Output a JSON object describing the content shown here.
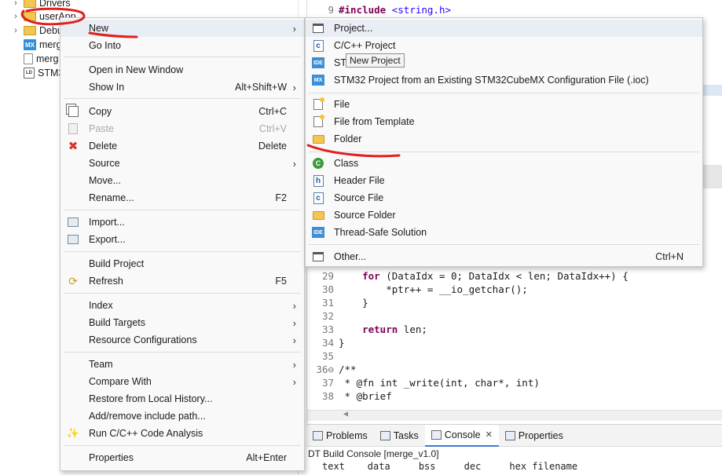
{
  "explorer": {
    "items": [
      {
        "name": "Drivers",
        "icon": "folder-icon",
        "arrow": "›"
      },
      {
        "name": "userApp",
        "icon": "folder-icon",
        "arrow": "›"
      },
      {
        "name": "Debu",
        "icon": "folder-icon",
        "arrow": "›"
      },
      {
        "name": "merg",
        "icon": "mx-file-icon",
        "icon_text": "MX"
      },
      {
        "name": "merg",
        "icon": "file-icon"
      },
      {
        "name": "STM3",
        "icon": "ld-file-icon",
        "icon_text": "LD"
      }
    ]
  },
  "editor": {
    "lines": [
      {
        "num": "9",
        "kw": "#include",
        "rest": " <string.h>"
      },
      {
        "num": "29",
        "text": "    for (DataIdx = 0; DataIdx < len; DataIdx++) {",
        "kw": "for"
      },
      {
        "num": "30",
        "text": "        *ptr++ = __io_getchar();"
      },
      {
        "num": "31",
        "text": "    }"
      },
      {
        "num": "32",
        "text": ""
      },
      {
        "num": "33",
        "text": "    return len;",
        "kw": "return"
      },
      {
        "num": "34",
        "text": "}"
      },
      {
        "num": "35",
        "text": ""
      },
      {
        "num": "36⊖",
        "text": "/**"
      },
      {
        "num": "37",
        "text": " * @fn int _write(int, char*, int)"
      },
      {
        "num": "38",
        "text": " * @brief"
      }
    ]
  },
  "bottom_panel": {
    "tabs": [
      "Problems",
      "Tasks",
      "Console",
      "Properties"
    ],
    "active_tab": "Console",
    "console_title": "DT Build Console [merge_v1.0]",
    "console_header": "text    data     bss     dec     hex filename"
  },
  "context_menu": {
    "items": [
      {
        "label": "New",
        "submenu": true,
        "icon": ""
      },
      {
        "label": "Go Into",
        "icon": ""
      },
      {
        "label": "Open in New Window",
        "icon": ""
      },
      {
        "label": "Show In",
        "accel": "Alt+Shift+W",
        "submenu": true
      },
      {
        "label": "Copy",
        "accel": "Ctrl+C",
        "icon": "copy-icon"
      },
      {
        "label": "Paste",
        "accel": "Ctrl+V",
        "icon": "paste-icon",
        "disabled": true
      },
      {
        "label": "Delete",
        "accel": "Delete",
        "icon": "delete-icon"
      },
      {
        "label": "Source",
        "submenu": true
      },
      {
        "label": "Move..."
      },
      {
        "label": "Rename...",
        "accel": "F2"
      },
      {
        "label": "Import...",
        "icon": "import-icon"
      },
      {
        "label": "Export...",
        "icon": "export-icon"
      },
      {
        "label": "Build Project"
      },
      {
        "label": "Refresh",
        "accel": "F5",
        "icon": "refresh-icon"
      },
      {
        "label": "Index",
        "submenu": true
      },
      {
        "label": "Build Targets",
        "submenu": true
      },
      {
        "label": "Resource Configurations",
        "submenu": true
      },
      {
        "label": "Team",
        "submenu": true
      },
      {
        "label": "Compare With",
        "submenu": true
      },
      {
        "label": "Restore from Local History..."
      },
      {
        "label": "Add/remove include path..."
      },
      {
        "label": "Run C/C++ Code Analysis",
        "icon": "code-analysis-icon"
      },
      {
        "label": "Properties",
        "accel": "Alt+Enter"
      }
    ]
  },
  "new_submenu": {
    "items": [
      {
        "label": "Project...",
        "icon": "project-icon"
      },
      {
        "label": "C/C++ Project",
        "icon": "cpp-project-icon",
        "icon_text": "c"
      },
      {
        "label": "STI",
        "icon": "ide-icon",
        "icon_text": "IDE"
      },
      {
        "label": "STM32 Project from an Existing STM32CubeMX Configuration File (.ioc)",
        "icon": "mx-icon",
        "icon_text": "MX"
      },
      {
        "label": "File",
        "icon": "file-icon"
      },
      {
        "label": "File from Template",
        "icon": "file-template-icon"
      },
      {
        "label": "Folder",
        "icon": "folder-icon"
      },
      {
        "label": "Class",
        "icon": "class-icon",
        "icon_text": "C"
      },
      {
        "label": "Header File",
        "icon": "header-file-icon",
        "icon_text": "h"
      },
      {
        "label": "Source File",
        "icon": "source-file-icon",
        "icon_text": "c"
      },
      {
        "label": "Source Folder",
        "icon": "source-folder-icon"
      },
      {
        "label": "Thread-Safe Solution",
        "icon": "ide-icon",
        "icon_text": "IDE"
      },
      {
        "label": "Other...",
        "accel": "Ctrl+N",
        "icon": "other-icon"
      }
    ]
  },
  "tooltip": "New Project",
  "colors": {
    "accent_red": "#e0201e",
    "menu_bg": "#f9f9f9",
    "keyword": "#7f0055"
  }
}
